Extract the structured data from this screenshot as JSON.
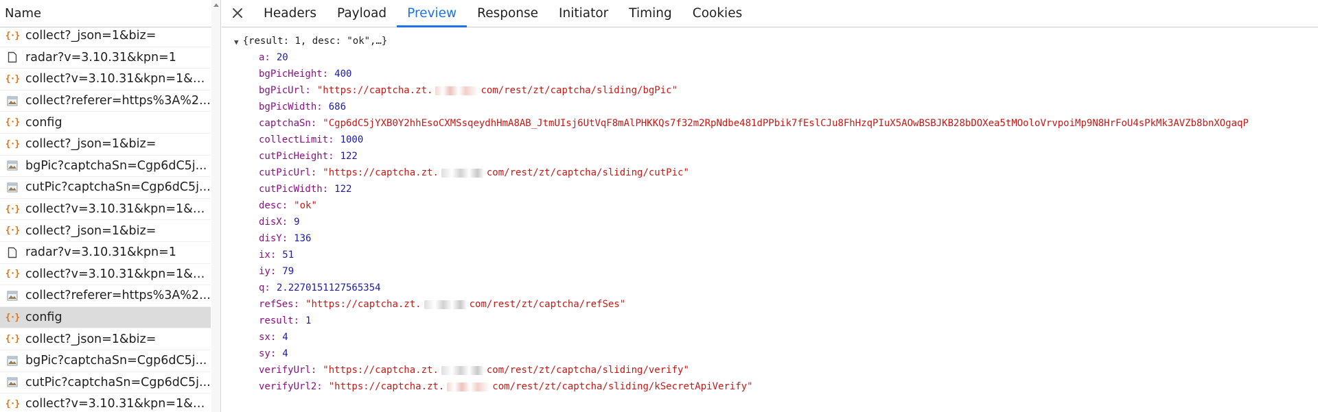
{
  "left_panel": {
    "header": "Name",
    "requests": [
      {
        "icon": "json-icon",
        "label": "collect?_json=1&biz="
      },
      {
        "icon": "document-icon",
        "label": "radar?v=3.10.31&kpn=1"
      },
      {
        "icon": "json-icon",
        "label": "collect?v=3.10.31&kpn=1&_j..."
      },
      {
        "icon": "image-icon",
        "label": "collect?referer=https%3A%2..."
      },
      {
        "icon": "json-icon",
        "label": "config"
      },
      {
        "icon": "json-icon",
        "label": "collect?_json=1&biz="
      },
      {
        "icon": "image-icon",
        "label": "bgPic?captchaSn=Cgp6dC5j..."
      },
      {
        "icon": "image-icon",
        "label": "cutPic?captchaSn=Cgp6dC5j..."
      },
      {
        "icon": "json-icon",
        "label": "collect?v=3.10.31&kpn=1&_j..."
      },
      {
        "icon": "json-icon",
        "label": "collect?_json=1&biz="
      },
      {
        "icon": "document-icon",
        "label": "radar?v=3.10.31&kpn=1"
      },
      {
        "icon": "json-icon",
        "label": "collect?v=3.10.31&kpn=1&_j..."
      },
      {
        "icon": "image-icon",
        "label": "collect?referer=https%3A%2..."
      },
      {
        "icon": "json-icon",
        "label": "config",
        "selected": true
      },
      {
        "icon": "json-icon",
        "label": "collect?_json=1&biz="
      },
      {
        "icon": "image-icon",
        "label": "bgPic?captchaSn=Cgp6dC5j..."
      },
      {
        "icon": "image-icon",
        "label": "cutPic?captchaSn=Cgp6dC5j..."
      },
      {
        "icon": "json-icon",
        "label": "collect?v=3.10.31&kpn=1&_j..."
      }
    ]
  },
  "tabs": {
    "close_icon": "close-icon",
    "items": [
      "Headers",
      "Payload",
      "Preview",
      "Response",
      "Initiator",
      "Timing",
      "Cookies"
    ],
    "active": "Preview"
  },
  "preview": {
    "summary": "{result: 1, desc: \"ok\",…}",
    "properties": [
      {
        "key": "a",
        "type": "num",
        "value": "20"
      },
      {
        "key": "bgPicHeight",
        "type": "num",
        "value": "400"
      },
      {
        "key": "bgPicUrl",
        "type": "str",
        "prefix": "\"https://captcha.zt.",
        "suffix": " com/rest/zt/captcha/sliding/bgPic\""
      },
      {
        "key": "bgPicWidth",
        "type": "num",
        "value": "686"
      },
      {
        "key": "captchaSn",
        "type": "str",
        "value": "\"Cgp6dC5jYXB0Y2hhEsoCXMSsqeydhHmA8AB_JtmUIsj6UtVqF8mAlPHKKQs7f32m2RpNdbe481dPPbik7fEslCJu8FhHzqPIuX5AOwBSBJKB28bDOXea5tMOoloVrvpoiMp9N8HrFoU4sPkMk3AVZb8bnXOgaqP"
      },
      {
        "key": "collectLimit",
        "type": "num",
        "value": "1000"
      },
      {
        "key": "cutPicHeight",
        "type": "num",
        "value": "122"
      },
      {
        "key": "cutPicUrl",
        "type": "str",
        "prefix": "\"https://captcha.zt.",
        "suffix": " com/rest/zt/captcha/sliding/cutPic\""
      },
      {
        "key": "cutPicWidth",
        "type": "num",
        "value": "122"
      },
      {
        "key": "desc",
        "type": "str",
        "value": "\"ok\""
      },
      {
        "key": "disX",
        "type": "num",
        "value": "9"
      },
      {
        "key": "disY",
        "type": "num",
        "value": "136"
      },
      {
        "key": "ix",
        "type": "num",
        "value": "51"
      },
      {
        "key": "iy",
        "type": "num",
        "value": "79"
      },
      {
        "key": "q",
        "type": "num",
        "value": "2.2270151127565354"
      },
      {
        "key": "refSes",
        "type": "str",
        "prefix": "\"https://captcha.zt.",
        "suffix": " com/rest/zt/captcha/refSes\""
      },
      {
        "key": "result",
        "type": "num",
        "value": "1"
      },
      {
        "key": "sx",
        "type": "num",
        "value": "4"
      },
      {
        "key": "sy",
        "type": "num",
        "value": "4"
      },
      {
        "key": "verifyUrl",
        "type": "str",
        "prefix": "\"https://captcha.zt.",
        "suffix": " com/rest/zt/captcha/sliding/verify\""
      },
      {
        "key": "verifyUrl2",
        "type": "str",
        "prefix": "\"https://captcha.zt.",
        "suffix": " com/rest/zt/captcha/sliding/kSecretApiVerify\""
      }
    ]
  },
  "colors": {
    "accent": "#1a73e8",
    "json_key": "#881280",
    "json_number": "#1a1aa6",
    "json_string": "#c41a16",
    "json_icon": "#e8710a",
    "selected_row": "#dcdcdc"
  }
}
